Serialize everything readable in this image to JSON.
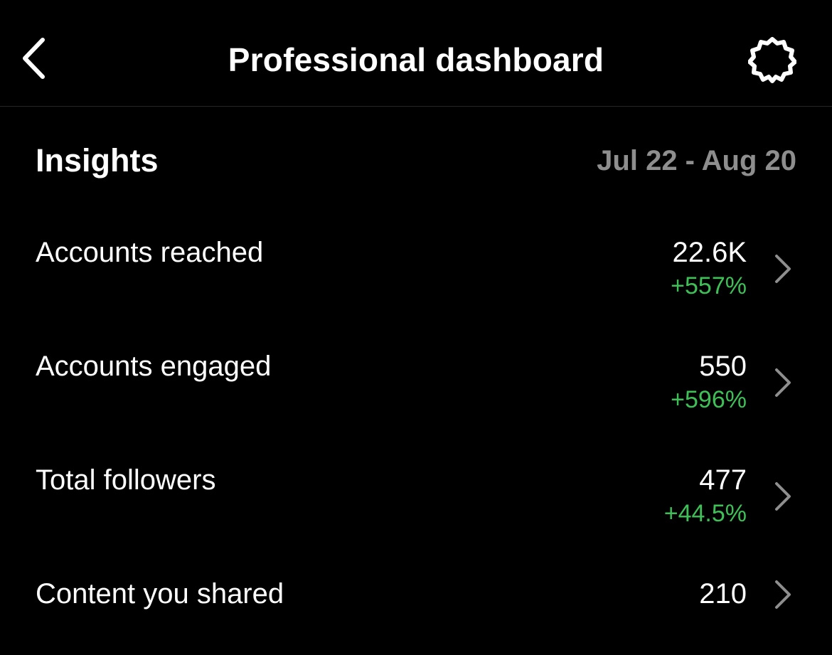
{
  "header": {
    "title": "Professional dashboard",
    "back_icon": "chevron-left-icon",
    "settings_icon": "gear-icon"
  },
  "insights": {
    "title": "Insights",
    "date_range": "Jul 22 - Aug 20",
    "rows": [
      {
        "label": "Accounts reached",
        "value": "22.6K",
        "change": "+557%"
      },
      {
        "label": "Accounts engaged",
        "value": "550",
        "change": "+596%"
      },
      {
        "label": "Total followers",
        "value": "477",
        "change": "+44.5%"
      },
      {
        "label": "Content you shared",
        "value": "210"
      }
    ]
  },
  "colors": {
    "background": "#000000",
    "text": "#ffffff",
    "muted": "#8e8e8e",
    "positive": "#3fbf58",
    "chevron": "#8e8e8e"
  }
}
